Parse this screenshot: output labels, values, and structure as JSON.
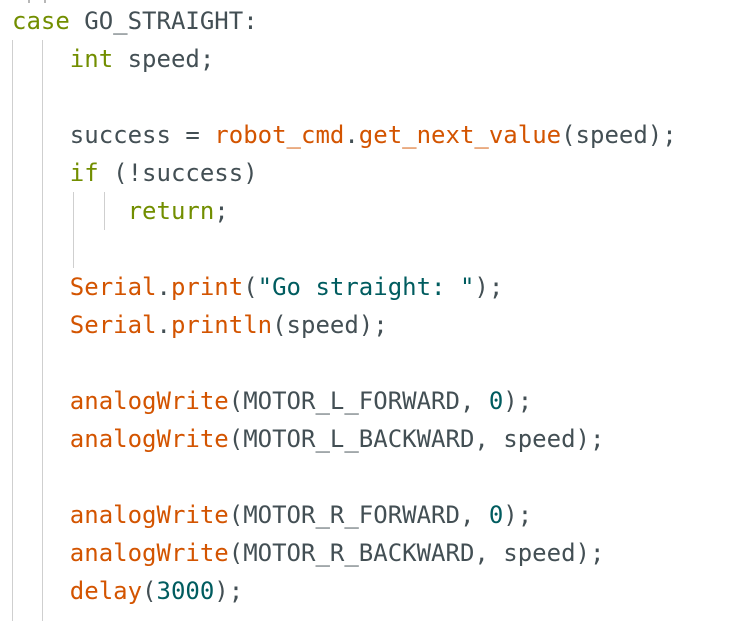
{
  "colors": {
    "background": "#ffffff",
    "plain": "#434f54",
    "keyword": "#728e00",
    "function": "#d35400",
    "literal": "#005c5f",
    "indent_guide": "#cfcfcf"
  },
  "code": {
    "lines": [
      [
        {
          "t": "case",
          "k": "keyword"
        },
        {
          "t": " GO_STRAIGHT:",
          "k": "plain"
        }
      ],
      [
        {
          "t": "    ",
          "k": "plain"
        },
        {
          "t": "int",
          "k": "keyword"
        },
        {
          "t": " speed;",
          "k": "plain"
        }
      ],
      [],
      [
        {
          "t": "    success = ",
          "k": "plain"
        },
        {
          "t": "robot_cmd",
          "k": "func"
        },
        {
          "t": ".",
          "k": "plain"
        },
        {
          "t": "get_next_value",
          "k": "func"
        },
        {
          "t": "(speed);",
          "k": "plain"
        }
      ],
      [
        {
          "t": "    ",
          "k": "plain"
        },
        {
          "t": "if",
          "k": "keyword"
        },
        {
          "t": " (!success)",
          "k": "plain"
        }
      ],
      [
        {
          "t": "        ",
          "k": "plain"
        },
        {
          "t": "return",
          "k": "keyword"
        },
        {
          "t": ";",
          "k": "plain"
        }
      ],
      [],
      [
        {
          "t": "    ",
          "k": "plain"
        },
        {
          "t": "Serial",
          "k": "func"
        },
        {
          "t": ".",
          "k": "plain"
        },
        {
          "t": "print",
          "k": "func"
        },
        {
          "t": "(",
          "k": "plain"
        },
        {
          "t": "\"Go straight: \"",
          "k": "string"
        },
        {
          "t": ");",
          "k": "plain"
        }
      ],
      [
        {
          "t": "    ",
          "k": "plain"
        },
        {
          "t": "Serial",
          "k": "func"
        },
        {
          "t": ".",
          "k": "plain"
        },
        {
          "t": "println",
          "k": "func"
        },
        {
          "t": "(speed);",
          "k": "plain"
        }
      ],
      [],
      [
        {
          "t": "    ",
          "k": "plain"
        },
        {
          "t": "analogWrite",
          "k": "func"
        },
        {
          "t": "(MOTOR_L_FORWARD, ",
          "k": "plain"
        },
        {
          "t": "0",
          "k": "number"
        },
        {
          "t": ");",
          "k": "plain"
        }
      ],
      [
        {
          "t": "    ",
          "k": "plain"
        },
        {
          "t": "analogWrite",
          "k": "func"
        },
        {
          "t": "(MOTOR_L_BACKWARD, speed);",
          "k": "plain"
        }
      ],
      [],
      [
        {
          "t": "    ",
          "k": "plain"
        },
        {
          "t": "analogWrite",
          "k": "func"
        },
        {
          "t": "(MOTOR_R_FORWARD, ",
          "k": "plain"
        },
        {
          "t": "0",
          "k": "number"
        },
        {
          "t": ");",
          "k": "plain"
        }
      ],
      [
        {
          "t": "    ",
          "k": "plain"
        },
        {
          "t": "analogWrite",
          "k": "func"
        },
        {
          "t": "(MOTOR_R_BACKWARD, speed);",
          "k": "plain"
        }
      ],
      [
        {
          "t": "    ",
          "k": "plain"
        },
        {
          "t": "delay",
          "k": "func"
        },
        {
          "t": "(",
          "k": "plain"
        },
        {
          "t": "3000",
          "k": "number"
        },
        {
          "t": ");",
          "k": "plain"
        }
      ]
    ]
  }
}
